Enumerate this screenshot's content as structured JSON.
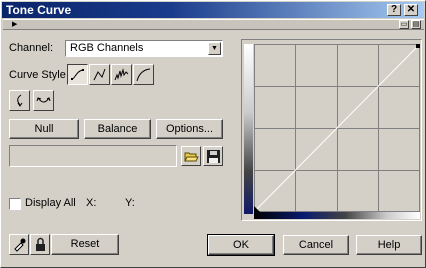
{
  "window": {
    "title": "Tone Curve",
    "help_btn": "?",
    "close_btn": "✕"
  },
  "channel": {
    "label": "Channel:",
    "value": "RGB Channels"
  },
  "curve_style": {
    "label": "Curve Style"
  },
  "buttons": {
    "null": "Null",
    "balance": "Balance",
    "options": "Options...",
    "reset": "Reset",
    "ok": "OK",
    "cancel": "Cancel",
    "help": "Help"
  },
  "display_all": {
    "label": "Display All",
    "checked": false
  },
  "readout": {
    "x_label": "X:",
    "y_label": "Y:"
  },
  "icons": {
    "curve_styles": [
      "curve-icon",
      "line-icon",
      "freehand-icon",
      "gamma-icon"
    ],
    "tools": [
      "swap-icon",
      "flip-icon"
    ],
    "file": [
      "open-folder-icon",
      "save-icon"
    ],
    "bottom": [
      "eyedropper-icon",
      "lock-icon"
    ]
  },
  "colors": {
    "title_bar": "#0a246a",
    "face": "#d4d0c8",
    "grid": "#808080"
  }
}
